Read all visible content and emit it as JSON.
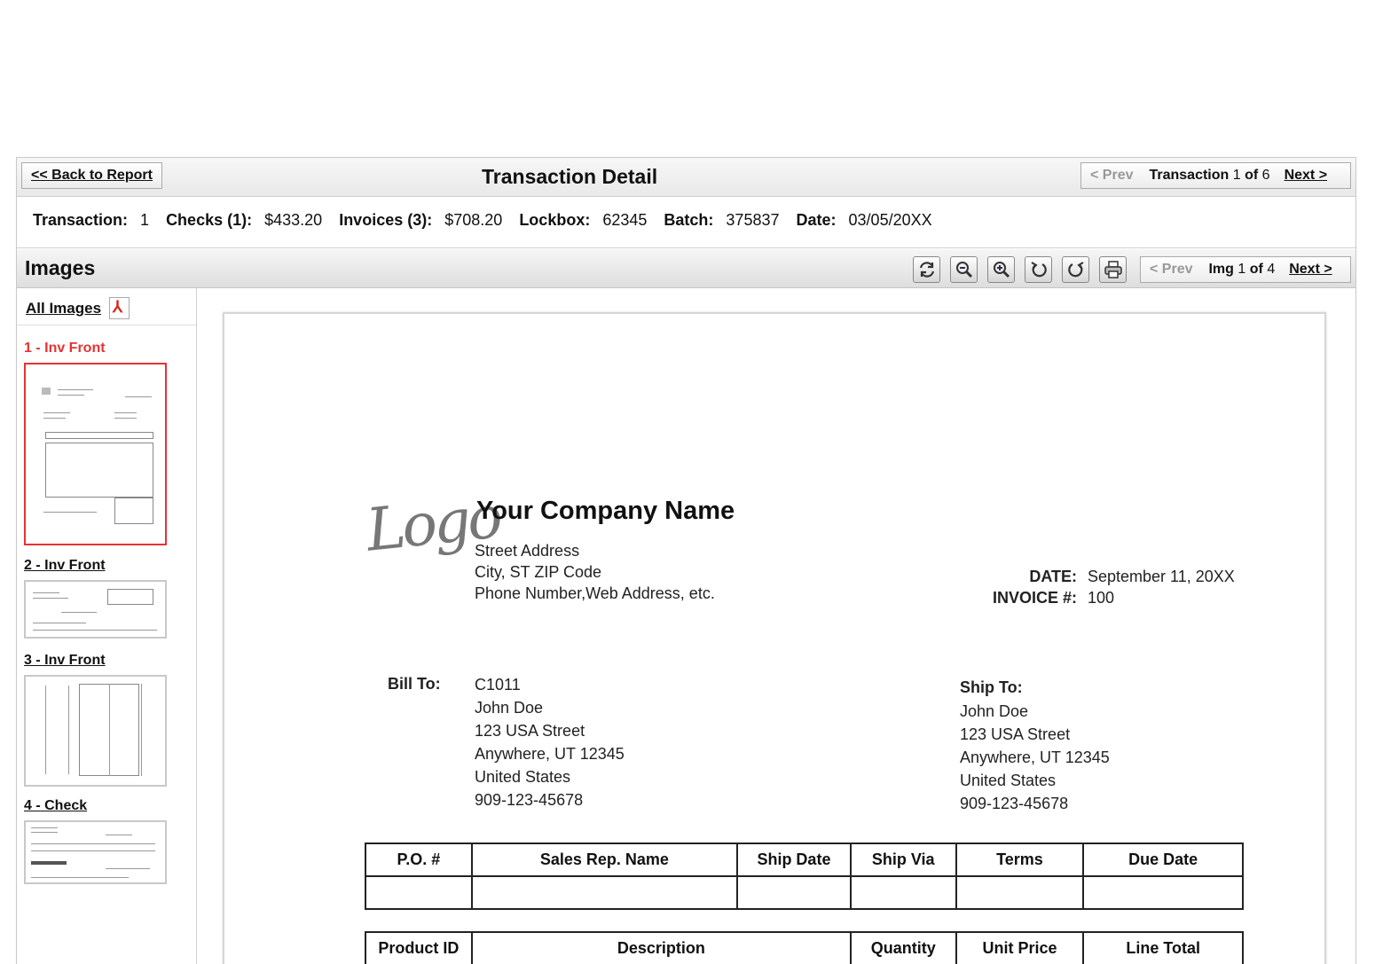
{
  "header": {
    "back_label": "<< Back to Report",
    "title": "Transaction Detail",
    "pager": {
      "prev": "< Prev",
      "label": "Transaction",
      "current": "1",
      "of": "of",
      "total": "6",
      "next": "Next >"
    }
  },
  "summary": {
    "transaction_label": "Transaction:",
    "transaction_value": "1",
    "checks_label": "Checks (1):",
    "checks_value": "$433.20",
    "invoices_label": "Invoices (3):",
    "invoices_value": "$708.20",
    "lockbox_label": "Lockbox:",
    "lockbox_value": "62345",
    "batch_label": "Batch:",
    "batch_value": "375837",
    "date_label": "Date:",
    "date_value": "03/05/20XX"
  },
  "images_bar": {
    "title": "Images",
    "tools": [
      "refresh-icon",
      "zoom-out-icon",
      "zoom-in-icon",
      "rotate-left-icon",
      "rotate-right-icon",
      "print-icon"
    ],
    "pager": {
      "prev": "< Prev",
      "label": "Img",
      "current": "1",
      "of": "of",
      "total": "4",
      "next": "Next >"
    }
  },
  "sidebar": {
    "all_images": "All Images",
    "thumbnails": [
      {
        "label": "1 - Inv Front",
        "active": true
      },
      {
        "label": "2 - Inv Front",
        "active": false
      },
      {
        "label": "3 - Inv Front",
        "active": false
      },
      {
        "label": "4 - Check",
        "active": false
      }
    ]
  },
  "document": {
    "logo": "Logo",
    "company_name": "Your Company Name",
    "address_lines": [
      "Street Address",
      "City, ST  ZIP Code",
      "Phone Number,Web Address, etc."
    ],
    "date_label": "DATE:",
    "date_value": "September 11, 20XX",
    "invoice_label": "INVOICE #:",
    "invoice_value": "100",
    "bill_to_label": "Bill To:",
    "bill_to_lines": [
      "C1011",
      "John Doe",
      "123 USA Street",
      "Anywhere, UT 12345",
      "United States",
      "909-123-45678"
    ],
    "ship_to_label": "Ship To:",
    "ship_to_lines": [
      "John Doe",
      "123 USA Street",
      "Anywhere, UT 12345",
      "United States",
      "909-123-45678"
    ],
    "order_table_headers": [
      "P.O. #",
      "Sales Rep. Name",
      "Ship Date",
      "Ship Via",
      "Terms",
      "Due Date"
    ],
    "items_table_headers": [
      "Product ID",
      "Description",
      "Quantity",
      "Unit Price",
      "Line Total"
    ]
  }
}
